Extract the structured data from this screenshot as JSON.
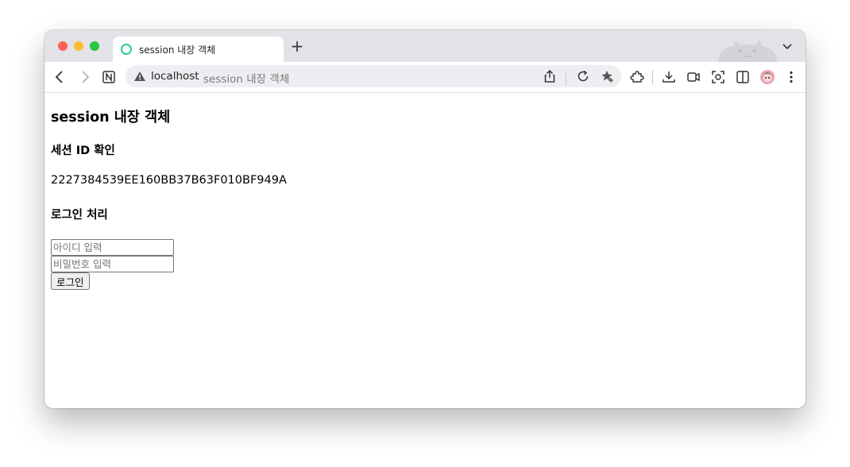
{
  "browser": {
    "tab_title": "session 내장 객체",
    "new_tab": "+",
    "address_host": "localhost",
    "address_title": "session 내장 객체",
    "icons": [
      "back-icon",
      "forward-icon",
      "notion-icon",
      "warning-icon",
      "share-icon",
      "reload-icon",
      "bookmark-star-icon",
      "extensions-icon",
      "download-icon",
      "record-icon",
      "screenshot-icon",
      "sidebar-icon",
      "avatar",
      "menu-icon",
      "tab-list-icon"
    ]
  },
  "page": {
    "heading": "session 내장 객체",
    "session_id_heading": "세션 ID 확인",
    "session_id_value": "2227384539EE160BB37B63F010BF949A",
    "login_heading": "로그인 처리",
    "id_placeholder": "아이디 입력",
    "password_placeholder": "비밀번호 입력",
    "login_button": "로그인"
  }
}
